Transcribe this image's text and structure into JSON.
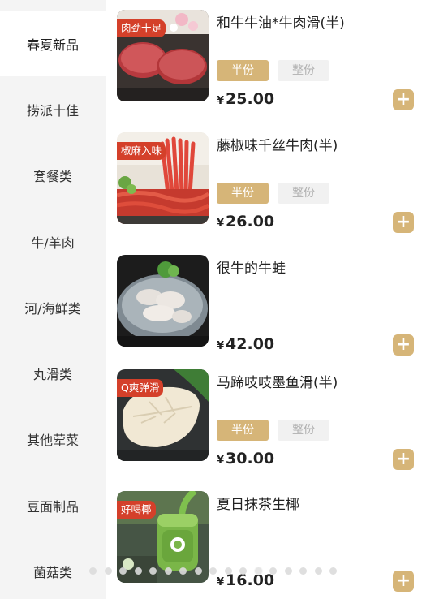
{
  "sidebar": {
    "categories": [
      "春夏新品",
      "捞派十佳",
      "套餐类",
      "牛/羊肉",
      "河/海鲜类",
      "丸滑类",
      "其他荤菜",
      "豆面制品",
      "菌菇类"
    ],
    "active_index": 0
  },
  "currency": "¥",
  "portion_labels": {
    "half": "半份",
    "whole": "整份"
  },
  "add_label": "+",
  "products": [
    {
      "name": "和牛牛油*牛肉滑(半)",
      "tag": "肉劲十足",
      "price": "25.00",
      "has_portions": true,
      "image": "beef-patty-image"
    },
    {
      "name": "藤椒味千丝牛肉(半)",
      "tag": "椒麻入味",
      "price": "26.00",
      "has_portions": true,
      "image": "shredded-beef-image"
    },
    {
      "name": "很牛的牛蛙",
      "tag": "",
      "price": "42.00",
      "has_portions": false,
      "image": "bullfrog-image"
    },
    {
      "name": "马蹄吱吱墨鱼滑(半)",
      "tag": "Q爽弹滑",
      "price": "30.00",
      "has_portions": true,
      "image": "cuttlefish-paste-image"
    },
    {
      "name": "夏日抹茶生椰",
      "tag": "好喝椰",
      "price": "16.00",
      "has_portions": false,
      "image": "matcha-coconut-drink-image"
    }
  ],
  "pagination": {
    "count": 17,
    "active_index": 11
  },
  "colors": {
    "accent": "#d6b578",
    "tag": "#d4402a",
    "sidebar_bg": "#f4f4f4",
    "whole_bg": "#f1f1f1"
  }
}
